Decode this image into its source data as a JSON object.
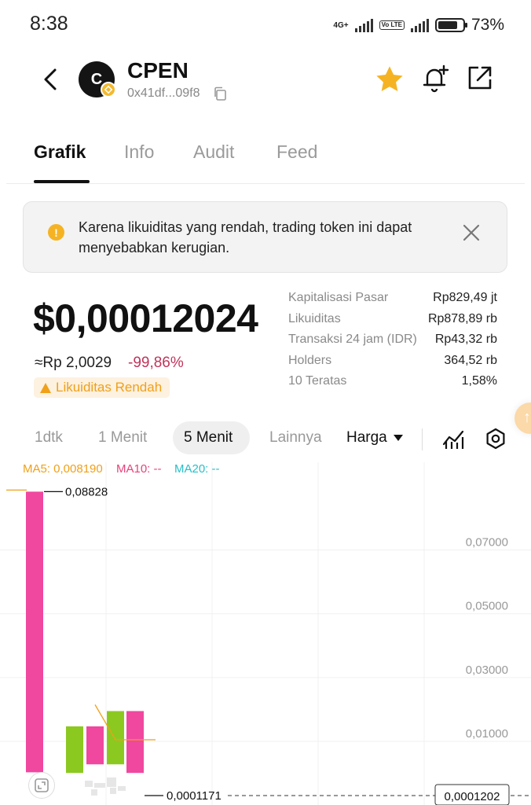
{
  "status_bar": {
    "time": "8:38",
    "network": "4G+",
    "volte": "Vo LTE",
    "battery_percent_label": "73%",
    "battery_level": 0.73
  },
  "header": {
    "logo_letter": "C",
    "token_name": "CPEN",
    "address": "0x41df...09f8",
    "icons": [
      "back-icon",
      "copy-icon",
      "star-icon",
      "bell-plus-icon",
      "share-icon"
    ]
  },
  "tabs": [
    {
      "label": "Grafik",
      "active": true
    },
    {
      "label": "Info",
      "active": false
    },
    {
      "label": "Audit",
      "active": false
    },
    {
      "label": "Feed",
      "active": false
    }
  ],
  "banner": {
    "text": "Karena likuiditas yang rendah, trading token ini dapat menyebabkan kerugian."
  },
  "price": {
    "usd": "$0,00012024",
    "idr": "≈Rp 2,0029",
    "change": "-99,86%",
    "liquidity_badge": "Likuiditas Rendah"
  },
  "stats": [
    {
      "label": "Kapitalisasi Pasar",
      "value": "Rp829,49 jt"
    },
    {
      "label": "Likuiditas",
      "value": "Rp878,89 rb"
    },
    {
      "label": "Transaksi 24 jam (IDR)",
      "value": "Rp43,32 rb"
    },
    {
      "label": "Holders",
      "value": "364,52 rb"
    },
    {
      "label": "10 Teratas",
      "value": "1,58%"
    }
  ],
  "toolbar": {
    "timeframes": [
      {
        "label": "1dtk",
        "active": false
      },
      {
        "label": "1 Menit",
        "active": false
      },
      {
        "label": "5 Menit",
        "active": true
      },
      {
        "label": "Lainnya",
        "active": false
      }
    ],
    "price_select": "Harga"
  },
  "ma_legend": {
    "ma5": "MA5: 0,008190",
    "ma10": "MA10: --",
    "ma20": "MA20: --"
  },
  "colors": {
    "up": "#8bc920",
    "down": "#f0479f",
    "ma5": "#f0a019",
    "ma10": "#e8417c",
    "ma20": "#26bfc9",
    "negative": "#c0345b",
    "warning": "#f5b324"
  },
  "chart_data": {
    "type": "candlestick",
    "y_ticks": [
      "0,07000",
      "0,05000",
      "0,03000",
      "0,01000"
    ],
    "y_tick_values": [
      0.07,
      0.05,
      0.03,
      0.01
    ],
    "ylim": [
      -0.00995,
      0.0975
    ],
    "grid": true,
    "high_label": "0,08828",
    "high_value": 0.08828,
    "low_label": "0,0001171",
    "low_value": 0.0001171,
    "current_label": "0,0001202",
    "current_value": 0.0001202,
    "candles": [
      {
        "open": 0.08828,
        "close": 0.0003,
        "high": 0.08828,
        "low": 0.0002,
        "dir": "down"
      },
      {
        "open": 0.0001,
        "close": 0.0147,
        "high": 0.0147,
        "low": 0.0001,
        "dir": "up"
      },
      {
        "open": 0.0147,
        "close": 0.0028,
        "high": 0.0147,
        "low": 0.0002,
        "dir": "down"
      },
      {
        "open": 0.0028,
        "close": 0.0195,
        "high": 0.0195,
        "low": 0.0002,
        "dir": "up"
      },
      {
        "open": 0.0195,
        "close": 0.0001,
        "high": 0.0195,
        "low": 0.0001171,
        "dir": "down"
      }
    ],
    "ma5_values": [
      0.0215,
      0.0105,
      0.0105,
      0.0105
    ]
  }
}
